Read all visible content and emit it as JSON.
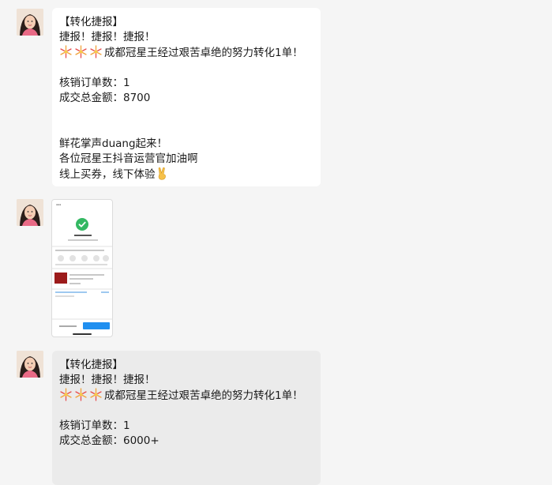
{
  "chat": {
    "messages": [
      {
        "kind": "text",
        "lines": [
          "【转化捷报】",
          "捷报！捷报！捷报！",
          "成都冠星王经过艰苦卓绝的努力转化1单！",
          "",
          "核销订单数：1",
          "成交总金额：8700",
          "",
          "",
          "鲜花掌声duang起来！",
          "各位冠星王抖音运营官加油啊",
          "线上买券，线下体验"
        ]
      },
      {
        "kind": "image",
        "thumbnail_icon": "order-verified-screenshot"
      },
      {
        "kind": "text",
        "lines": [
          "【转化捷报】",
          "捷报！捷报！捷报！",
          "成都冠星王经过艰苦卓绝的努力转化1单！",
          "",
          "核销订单数：1",
          "成交总金额：6000+"
        ]
      }
    ]
  },
  "colors": {
    "background": "#f5f5f5",
    "bubble": "#ffffff",
    "bubble_selected": "#ebebeb",
    "text": "#1a1a1a",
    "success_green": "#33b862",
    "button_blue": "#1f8ff0"
  },
  "icons": {
    "firework": "firework-emoji",
    "peace": "victory-hand-emoji",
    "avatar": "user-avatar"
  }
}
